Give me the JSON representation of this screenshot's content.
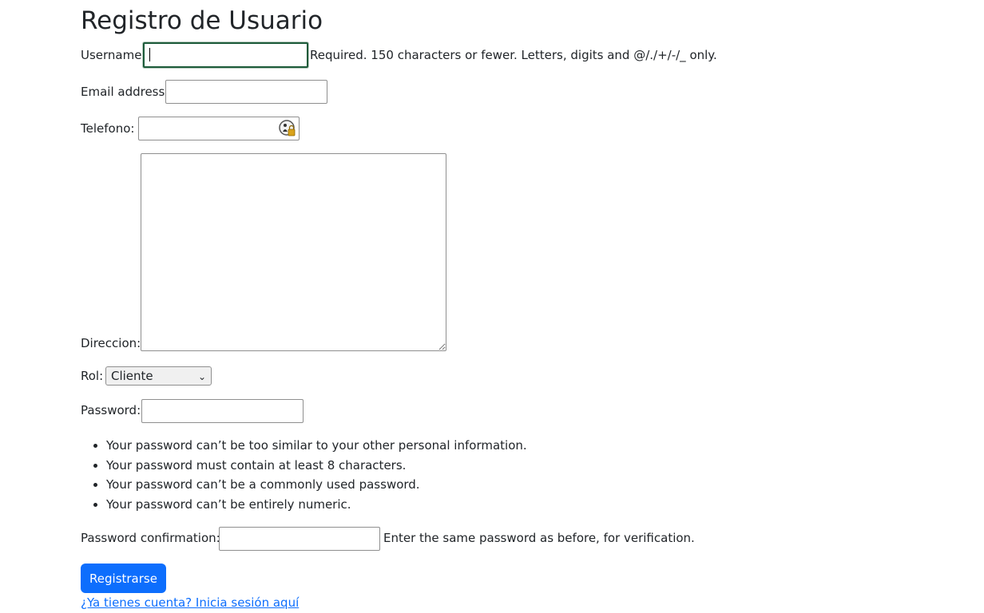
{
  "page": {
    "title": "Registro de Usuario"
  },
  "form": {
    "username": {
      "label": "Username:",
      "value": "",
      "help": "Required. 150 characters or fewer. Letters, digits and @/./+/-/_ only."
    },
    "email": {
      "label": "Email address:",
      "value": ""
    },
    "telefono": {
      "label": "Telefono:",
      "value": "",
      "icon": "password-manager-icon"
    },
    "direccion": {
      "label": "Direccion:",
      "value": ""
    },
    "rol": {
      "label": "Rol:",
      "selected": "Cliente",
      "icon": "chevron-down-icon"
    },
    "password": {
      "label": "Password:",
      "value": "",
      "rules": [
        "Your password can’t be too similar to your other personal information.",
        "Your password must contain at least 8 characters.",
        "Your password can’t be a commonly used password.",
        "Your password can’t be entirely numeric."
      ]
    },
    "password_confirmation": {
      "label": "Password confirmation:",
      "value": "",
      "help": "Enter the same password as before, for verification."
    },
    "submit_label": "Registrarse",
    "login_link": "¿Ya tienes cuenta? Inicia sesión aquí"
  },
  "colors": {
    "primary": "#0d6efd",
    "focus_border": "#1d5b3a",
    "text": "#212529"
  }
}
